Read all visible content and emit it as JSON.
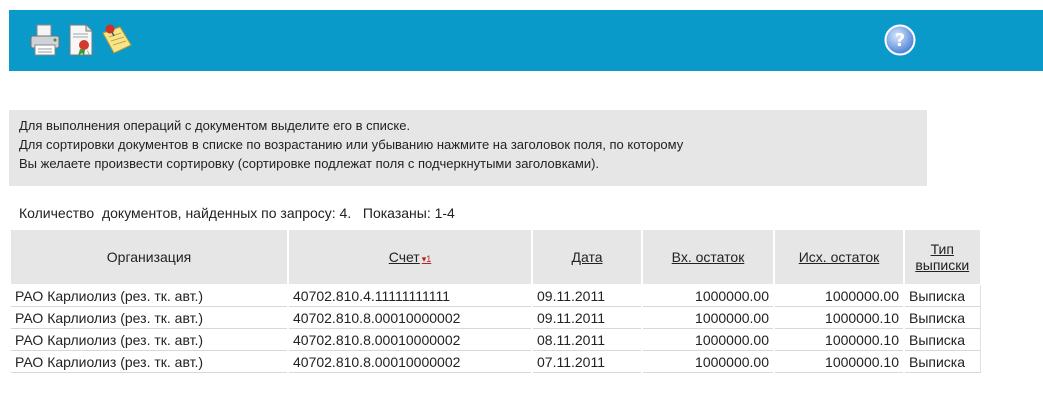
{
  "toolbar": {
    "bg_color": "#0a9ac9",
    "icons": [
      "printer-icon",
      "certificate-document-icon",
      "pinned-note-icon",
      "help-icon"
    ]
  },
  "info": {
    "line1": "Для выполнения операций с документом выделите его в списке.",
    "line2": "Для сортировки документов в списке по возрастанию или убыванию нажмите на заголовок поля, по которому",
    "line3": "Вы желаете произвести сортировку (сортировке подлежат поля с подчеркнутыми заголовками)."
  },
  "summary": {
    "found_label": "Количество  документов, найденных по запросу: ",
    "found_count": "4.",
    "shown_label": "   Показаны: ",
    "shown_range": "1-4"
  },
  "table": {
    "headers": {
      "org": "Организация",
      "account": "Счет",
      "account_sort": "▾1",
      "date": "Дата",
      "in_balance": "Вх. остаток",
      "out_balance": "Исх. остаток",
      "type_line1": "Тип",
      "type_line2": "выписки"
    },
    "rows": [
      {
        "org": "РАО Карлиолиз (рез. тк. авт.)",
        "account": "40702.810.4.11111111111",
        "date": "09.11.2011",
        "in_balance": "1000000.00",
        "out_balance": "1000000.00",
        "type": "Выписка"
      },
      {
        "org": "РАО Карлиолиз (рез. тк. авт.)",
        "account": "40702.810.8.00010000002",
        "date": "09.11.2011",
        "in_balance": "1000000.00",
        "out_balance": "1000000.10",
        "type": "Выписка"
      },
      {
        "org": "РАО Карлиолиз (рез. тк. авт.)",
        "account": "40702.810.8.00010000002",
        "date": "08.11.2011",
        "in_balance": "1000000.00",
        "out_balance": "1000000.10",
        "type": "Выписка"
      },
      {
        "org": "РАО Карлиолиз (рез. тк. авт.)",
        "account": "40702.810.8.00010000002",
        "date": "07.11.2011",
        "in_balance": "1000000.00",
        "out_balance": "1000000.10",
        "type": "Выписка"
      }
    ]
  }
}
